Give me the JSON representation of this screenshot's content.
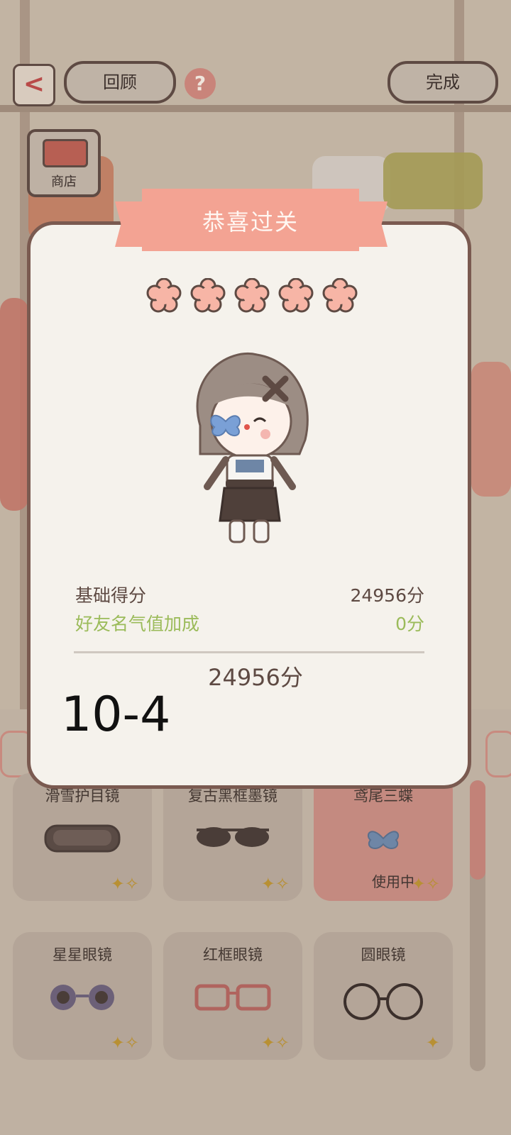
{
  "topbar": {
    "back_glyph": "<",
    "review_label": "回顾",
    "help_glyph": "?",
    "done_label": "完成"
  },
  "shop": {
    "label": "商店"
  },
  "modal": {
    "title": "恭喜过关",
    "stars_earned": 5,
    "stars_total": 5,
    "base_score_label": "基础得分",
    "base_score_value": "24956分",
    "bonus_label": "好友名气值加成",
    "bonus_value": "0分",
    "total_value": "24956分",
    "level": "10-4"
  },
  "items": [
    {
      "label": "滑雪护目镜",
      "icon": "ski-goggles-icon",
      "using": ""
    },
    {
      "label": "复古黑框墨镜",
      "icon": "black-sunglasses-icon",
      "using": ""
    },
    {
      "label": "鸢尾三蝶",
      "icon": "blue-flower-icon",
      "using": "使用中"
    },
    {
      "label": "星星眼镜",
      "icon": "flower-glasses-icon",
      "using": ""
    },
    {
      "label": "红框眼镜",
      "icon": "red-glasses-icon",
      "using": ""
    },
    {
      "label": "圆眼镜",
      "icon": "round-glasses-icon",
      "using": ""
    }
  ],
  "colors": {
    "accent": "#f3a393",
    "bonus_text": "#9bbb5a",
    "text_dark": "#5e4a43"
  }
}
